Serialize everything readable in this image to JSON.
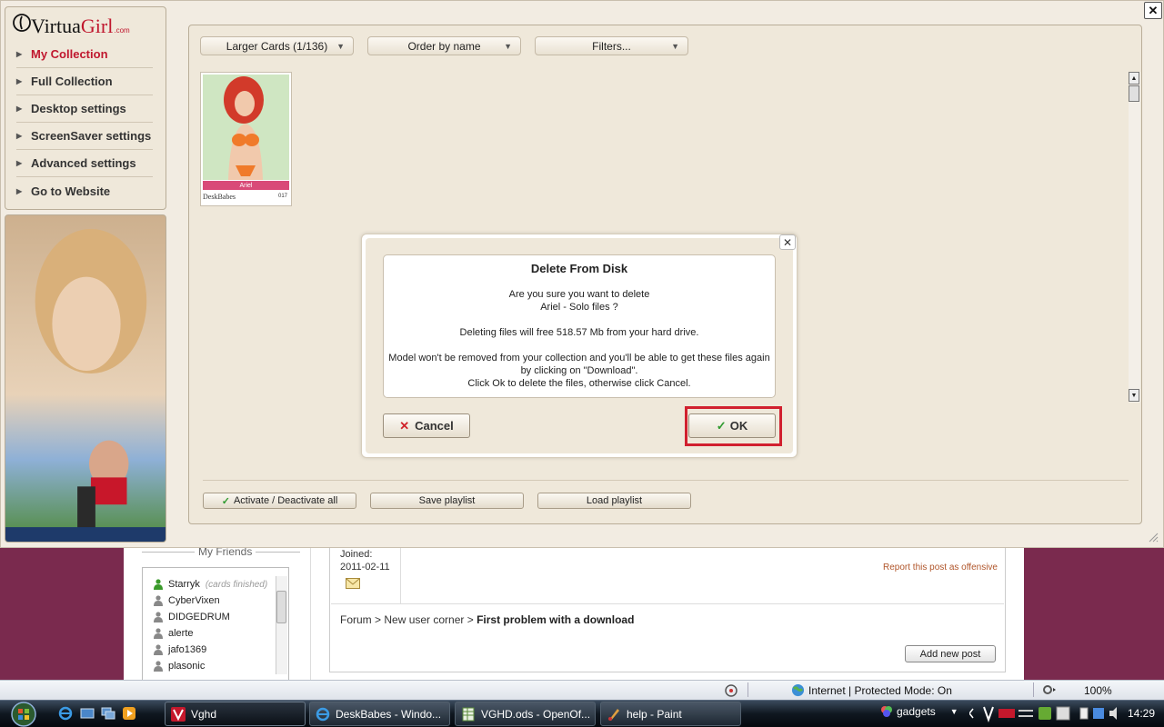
{
  "app": {
    "logo": {
      "part1": "Virtua",
      "part2": "Girl",
      "suffix": ".com"
    },
    "close_label": "✕",
    "menu": [
      {
        "label": "My Collection",
        "active": true
      },
      {
        "label": "Full Collection"
      },
      {
        "label": "Desktop settings"
      },
      {
        "label": "ScreenSaver settings"
      },
      {
        "label": "Advanced settings"
      },
      {
        "label": "Go to Website"
      }
    ],
    "toolbar": {
      "card_size": "Larger Cards (1/136)",
      "order": "Order by name",
      "filters": "Filters..."
    },
    "card": {
      "name": "Ariel",
      "brand": "DeskBabes",
      "number": "017"
    },
    "bottom_buttons": {
      "activate": "Activate / Deactivate all",
      "save": "Save playlist",
      "load": "Load playlist"
    }
  },
  "dialog": {
    "title": "Delete From Disk",
    "line1": "Are you sure you want to delete",
    "line2": "Ariel - Solo files ?",
    "line3": "Deleting files will free 518.57 Mb from your hard drive.",
    "line4": "Model won't be removed from your collection and you'll be able to get these files again",
    "line5": "by clicking on \"Download\".",
    "line6": "Click Ok to delete the files, otherwise click Cancel.",
    "cancel": "Cancel",
    "ok": "OK",
    "close": "✕"
  },
  "forum": {
    "friends_title": "My Friends",
    "friends": [
      {
        "name": "Starryk",
        "note": "(cards finished)",
        "online": true
      },
      {
        "name": "CyberVixen"
      },
      {
        "name": "DIDGEDRUM"
      },
      {
        "name": "alerte"
      },
      {
        "name": "jafo1369"
      },
      {
        "name": "plasonic"
      }
    ],
    "joined_label": "Joined:",
    "joined_date": "2011-02-11",
    "report_link": "Report this post as offensive",
    "breadcrumb": {
      "p1": "Forum",
      "sep": " > ",
      "p2": "New user corner",
      "p3": "First problem with a download"
    },
    "add_post": "Add new post"
  },
  "statusbar": {
    "zone": "Internet | Protected Mode: On",
    "zoom": "100%"
  },
  "taskbar": {
    "items": [
      {
        "label": "Vghd",
        "active": true
      },
      {
        "label": "DeskBabes - Windo..."
      },
      {
        "label": "VGHD.ods - OpenOf..."
      },
      {
        "label": "help - Paint"
      }
    ],
    "gadgets": "gadgets",
    "clock": "14:29"
  },
  "colors": {
    "brand_red": "#c0172e",
    "highlight": "#d1202f",
    "panel": "#efe8da",
    "background": "#7a2a4e"
  }
}
